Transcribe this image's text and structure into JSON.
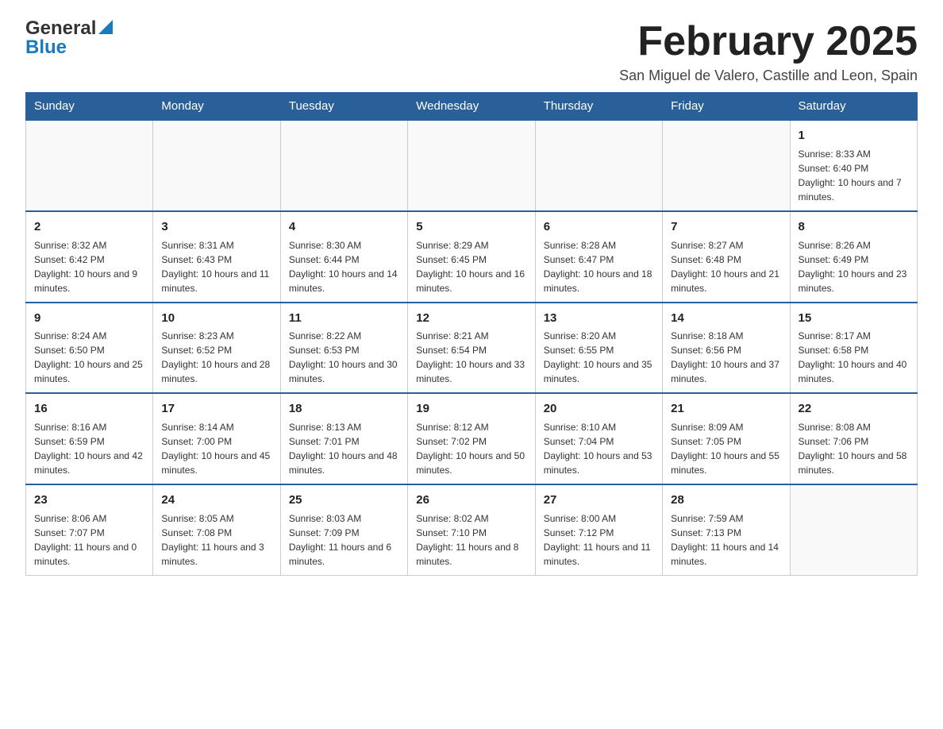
{
  "logo": {
    "general": "General",
    "blue": "Blue"
  },
  "header": {
    "month_year": "February 2025",
    "location": "San Miguel de Valero, Castille and Leon, Spain"
  },
  "weekdays": [
    "Sunday",
    "Monday",
    "Tuesday",
    "Wednesday",
    "Thursday",
    "Friday",
    "Saturday"
  ],
  "weeks": [
    {
      "days": [
        {
          "num": "",
          "info": ""
        },
        {
          "num": "",
          "info": ""
        },
        {
          "num": "",
          "info": ""
        },
        {
          "num": "",
          "info": ""
        },
        {
          "num": "",
          "info": ""
        },
        {
          "num": "",
          "info": ""
        },
        {
          "num": "1",
          "info": "Sunrise: 8:33 AM\nSunset: 6:40 PM\nDaylight: 10 hours and 7 minutes."
        }
      ]
    },
    {
      "days": [
        {
          "num": "2",
          "info": "Sunrise: 8:32 AM\nSunset: 6:42 PM\nDaylight: 10 hours and 9 minutes."
        },
        {
          "num": "3",
          "info": "Sunrise: 8:31 AM\nSunset: 6:43 PM\nDaylight: 10 hours and 11 minutes."
        },
        {
          "num": "4",
          "info": "Sunrise: 8:30 AM\nSunset: 6:44 PM\nDaylight: 10 hours and 14 minutes."
        },
        {
          "num": "5",
          "info": "Sunrise: 8:29 AM\nSunset: 6:45 PM\nDaylight: 10 hours and 16 minutes."
        },
        {
          "num": "6",
          "info": "Sunrise: 8:28 AM\nSunset: 6:47 PM\nDaylight: 10 hours and 18 minutes."
        },
        {
          "num": "7",
          "info": "Sunrise: 8:27 AM\nSunset: 6:48 PM\nDaylight: 10 hours and 21 minutes."
        },
        {
          "num": "8",
          "info": "Sunrise: 8:26 AM\nSunset: 6:49 PM\nDaylight: 10 hours and 23 minutes."
        }
      ]
    },
    {
      "days": [
        {
          "num": "9",
          "info": "Sunrise: 8:24 AM\nSunset: 6:50 PM\nDaylight: 10 hours and 25 minutes."
        },
        {
          "num": "10",
          "info": "Sunrise: 8:23 AM\nSunset: 6:52 PM\nDaylight: 10 hours and 28 minutes."
        },
        {
          "num": "11",
          "info": "Sunrise: 8:22 AM\nSunset: 6:53 PM\nDaylight: 10 hours and 30 minutes."
        },
        {
          "num": "12",
          "info": "Sunrise: 8:21 AM\nSunset: 6:54 PM\nDaylight: 10 hours and 33 minutes."
        },
        {
          "num": "13",
          "info": "Sunrise: 8:20 AM\nSunset: 6:55 PM\nDaylight: 10 hours and 35 minutes."
        },
        {
          "num": "14",
          "info": "Sunrise: 8:18 AM\nSunset: 6:56 PM\nDaylight: 10 hours and 37 minutes."
        },
        {
          "num": "15",
          "info": "Sunrise: 8:17 AM\nSunset: 6:58 PM\nDaylight: 10 hours and 40 minutes."
        }
      ]
    },
    {
      "days": [
        {
          "num": "16",
          "info": "Sunrise: 8:16 AM\nSunset: 6:59 PM\nDaylight: 10 hours and 42 minutes."
        },
        {
          "num": "17",
          "info": "Sunrise: 8:14 AM\nSunset: 7:00 PM\nDaylight: 10 hours and 45 minutes."
        },
        {
          "num": "18",
          "info": "Sunrise: 8:13 AM\nSunset: 7:01 PM\nDaylight: 10 hours and 48 minutes."
        },
        {
          "num": "19",
          "info": "Sunrise: 8:12 AM\nSunset: 7:02 PM\nDaylight: 10 hours and 50 minutes."
        },
        {
          "num": "20",
          "info": "Sunrise: 8:10 AM\nSunset: 7:04 PM\nDaylight: 10 hours and 53 minutes."
        },
        {
          "num": "21",
          "info": "Sunrise: 8:09 AM\nSunset: 7:05 PM\nDaylight: 10 hours and 55 minutes."
        },
        {
          "num": "22",
          "info": "Sunrise: 8:08 AM\nSunset: 7:06 PM\nDaylight: 10 hours and 58 minutes."
        }
      ]
    },
    {
      "days": [
        {
          "num": "23",
          "info": "Sunrise: 8:06 AM\nSunset: 7:07 PM\nDaylight: 11 hours and 0 minutes."
        },
        {
          "num": "24",
          "info": "Sunrise: 8:05 AM\nSunset: 7:08 PM\nDaylight: 11 hours and 3 minutes."
        },
        {
          "num": "25",
          "info": "Sunrise: 8:03 AM\nSunset: 7:09 PM\nDaylight: 11 hours and 6 minutes."
        },
        {
          "num": "26",
          "info": "Sunrise: 8:02 AM\nSunset: 7:10 PM\nDaylight: 11 hours and 8 minutes."
        },
        {
          "num": "27",
          "info": "Sunrise: 8:00 AM\nSunset: 7:12 PM\nDaylight: 11 hours and 11 minutes."
        },
        {
          "num": "28",
          "info": "Sunrise: 7:59 AM\nSunset: 7:13 PM\nDaylight: 11 hours and 14 minutes."
        },
        {
          "num": "",
          "info": ""
        }
      ]
    }
  ]
}
